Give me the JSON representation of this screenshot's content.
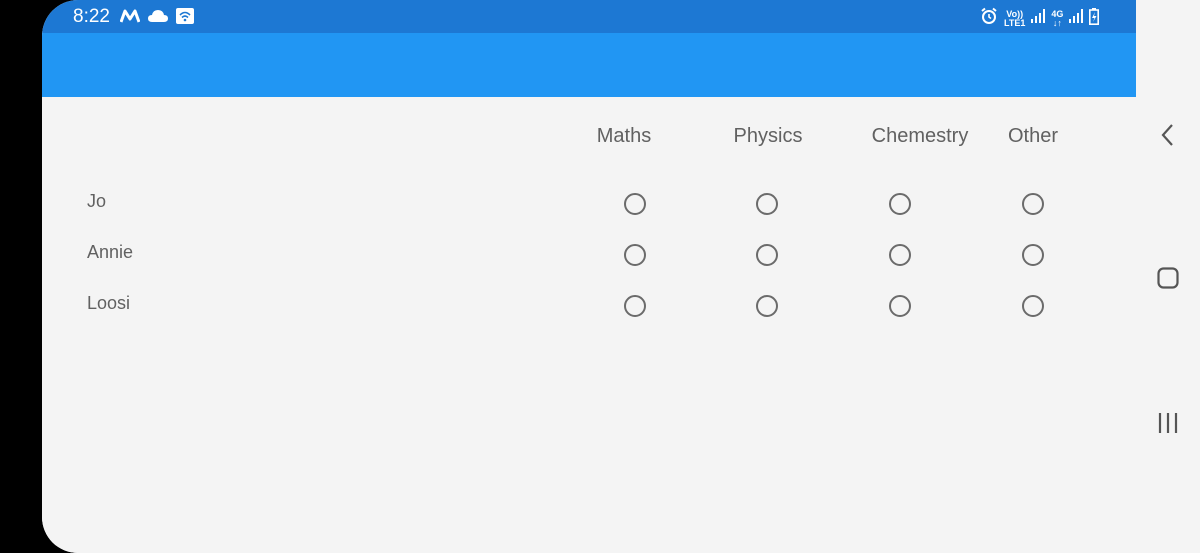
{
  "status_bar": {
    "time": "8:22",
    "left_icons": [
      "m-logo-icon",
      "cloud-icon",
      "wifi-box-icon"
    ],
    "volte_label": "Vo))",
    "lte_label": "LTE1",
    "fourg_label": "4G",
    "right_icons": [
      "alarm-icon",
      "signal-icon",
      "signal-icon-2",
      "battery-charging-icon"
    ]
  },
  "grid": {
    "columns": [
      "Maths",
      "Physics",
      "Chemestry",
      "Other"
    ],
    "rows": [
      {
        "label": "Jo",
        "selected": null
      },
      {
        "label": "Annie",
        "selected": null
      },
      {
        "label": "Loosi",
        "selected": null
      }
    ]
  },
  "colors": {
    "status_bar": "#1d78d3",
    "app_bar": "#2196f3",
    "background": "#f4f4f4",
    "text": "#616161"
  },
  "nav_bar": {
    "buttons": [
      "back-icon",
      "home-icon",
      "recent-apps-icon"
    ]
  }
}
